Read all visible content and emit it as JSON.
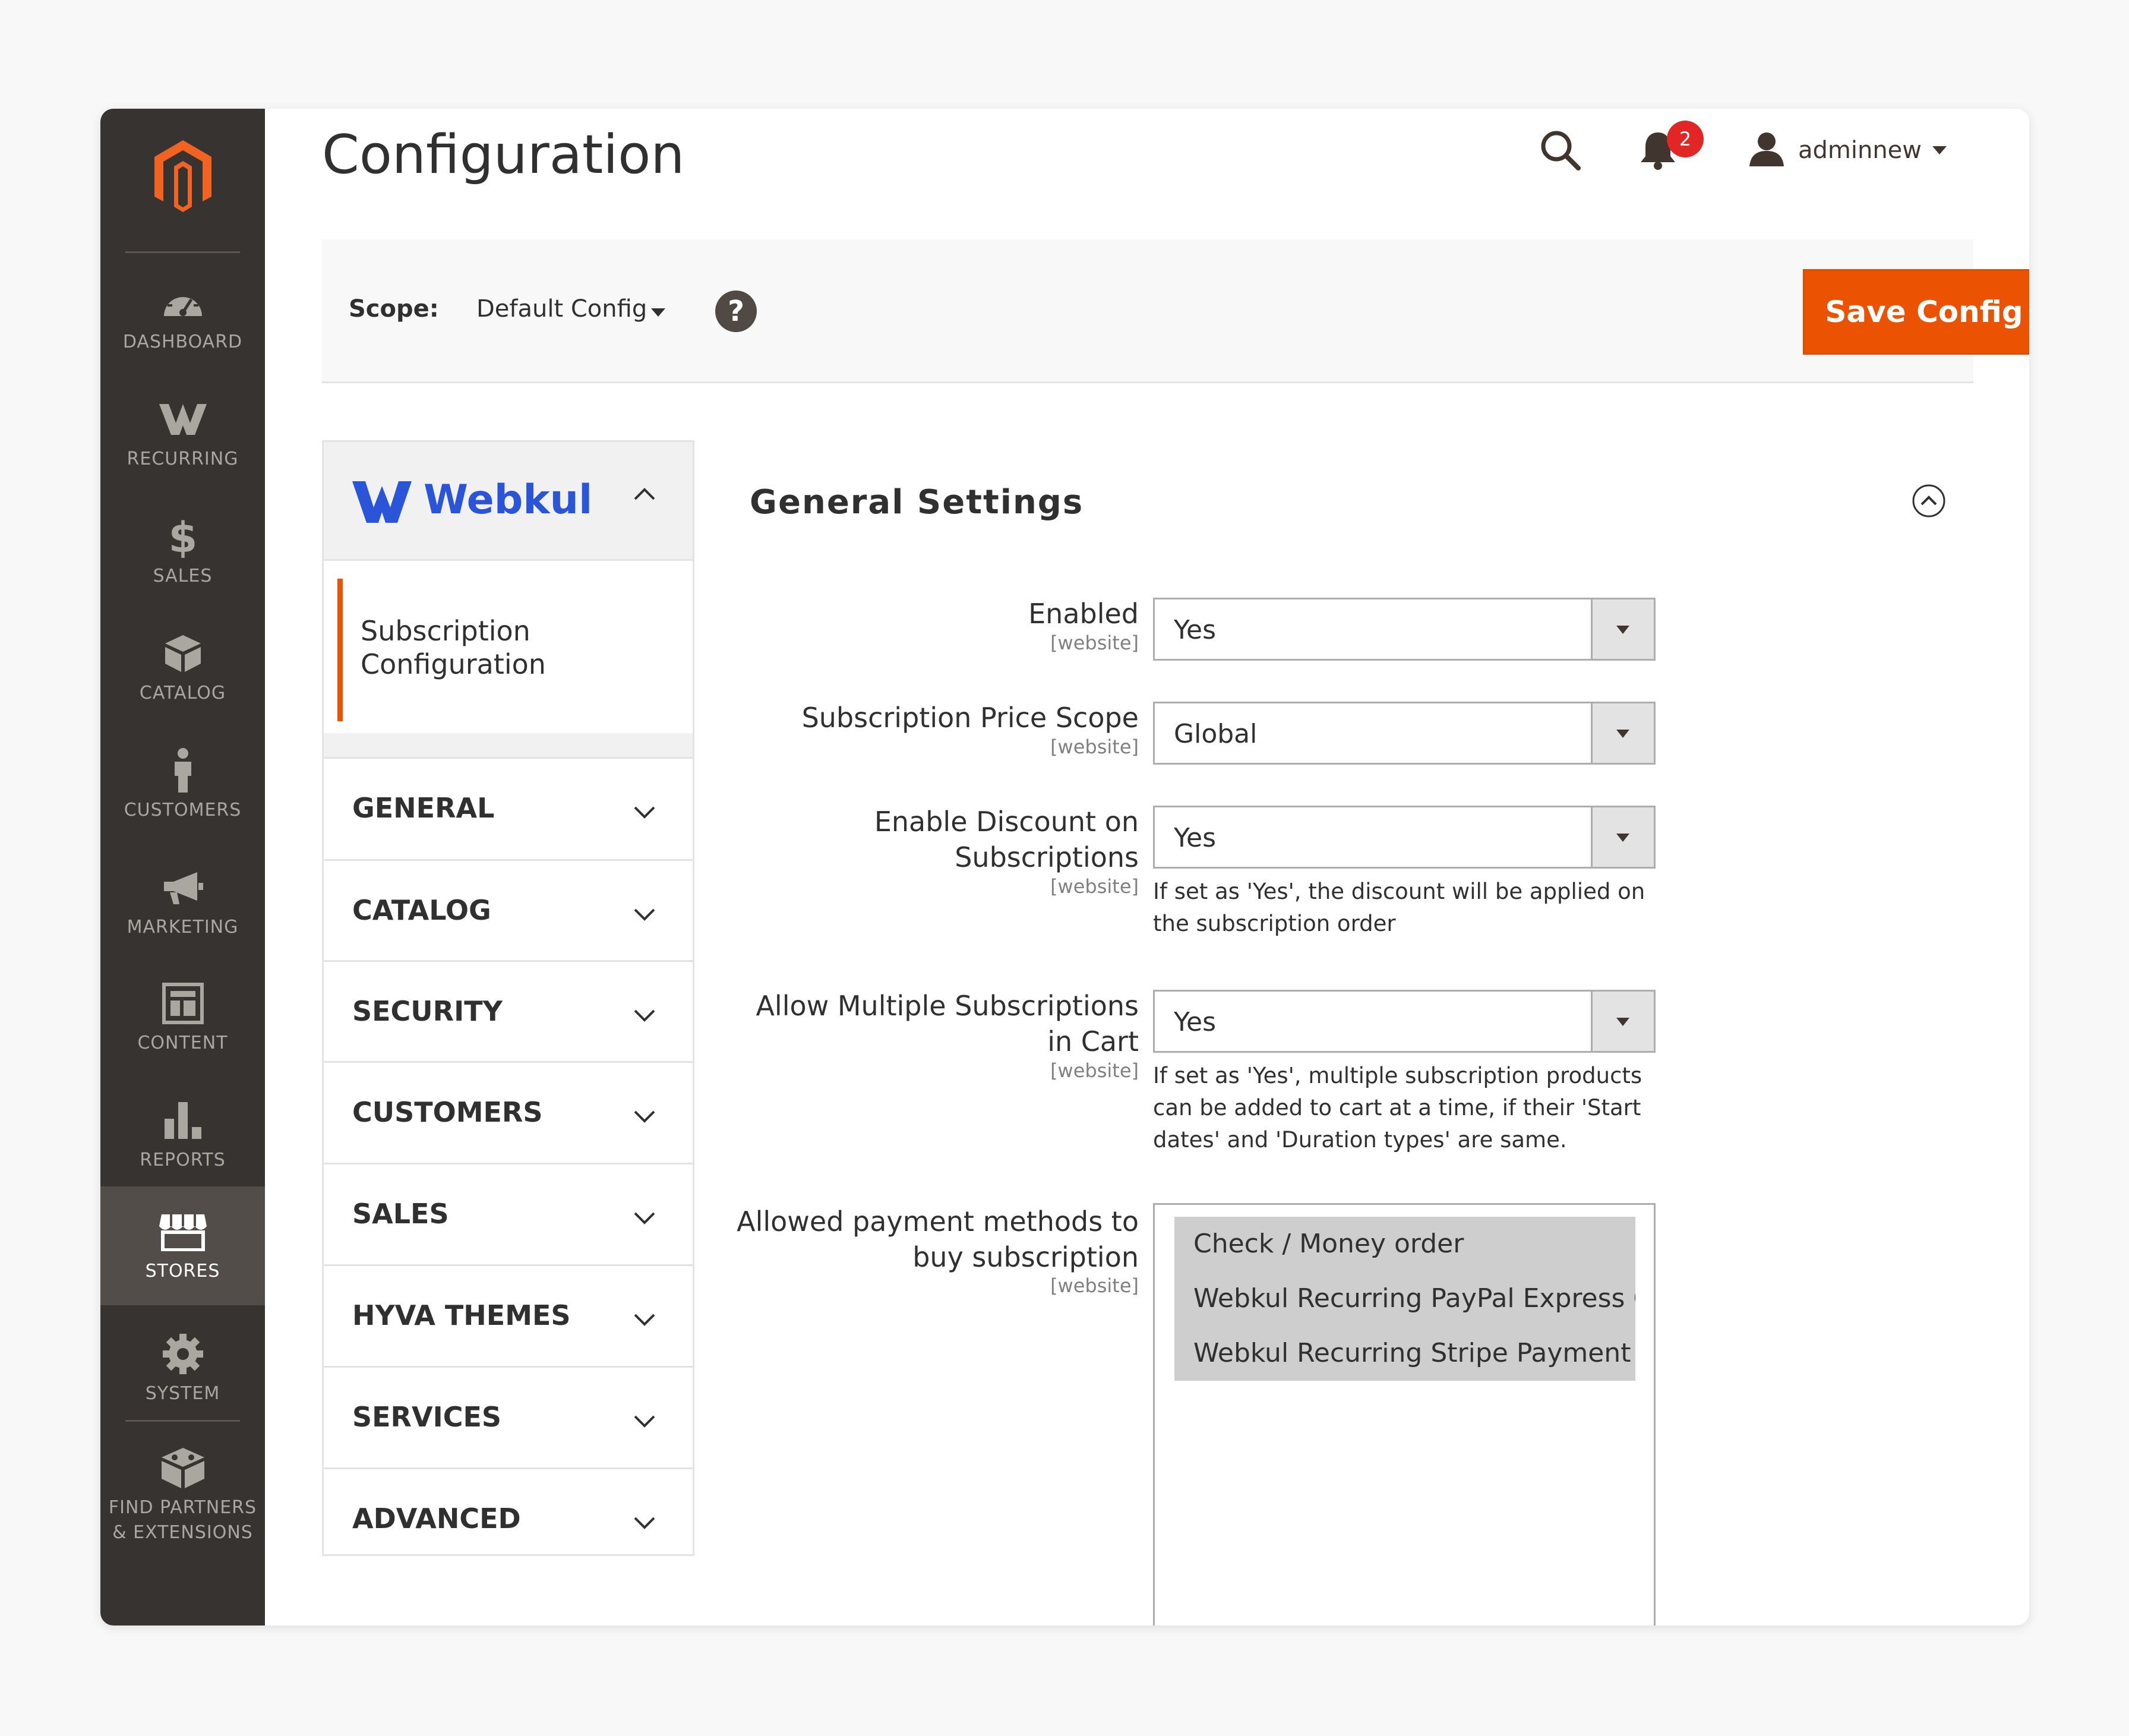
{
  "sidebar": {
    "logo": "magento-logo",
    "items": [
      {
        "label": "DASHBOARD",
        "icon": "dashboard-icon"
      },
      {
        "label": "RECURRING",
        "icon": "webkul-w-icon"
      },
      {
        "label": "SALES",
        "icon": "dollar-icon"
      },
      {
        "label": "CATALOG",
        "icon": "box-icon"
      },
      {
        "label": "CUSTOMERS",
        "icon": "person-icon"
      },
      {
        "label": "MARKETING",
        "icon": "megaphone-icon"
      },
      {
        "label": "CONTENT",
        "icon": "layout-icon"
      },
      {
        "label": "REPORTS",
        "icon": "bar-chart-icon"
      },
      {
        "label": "STORES",
        "icon": "store-icon",
        "active": true
      },
      {
        "label": "SYSTEM",
        "icon": "gear-icon"
      },
      {
        "label": "FIND PARTNERS\n& EXTENSIONS",
        "icon": "cube-icon"
      }
    ]
  },
  "header": {
    "title": "Configuration",
    "notifications_count": "2",
    "user": "adminnew"
  },
  "scope": {
    "label": "Scope:",
    "value": "Default Config",
    "save_label": "Save Config"
  },
  "tabs": {
    "brand": "Webkul",
    "active_item": "Subscription\nConfiguration",
    "sections": [
      "GENERAL",
      "CATALOG",
      "SECURITY",
      "CUSTOMERS",
      "SALES",
      "HYVA THEMES",
      "SERVICES",
      "ADVANCED"
    ]
  },
  "general_settings": {
    "title": "General Settings",
    "fields": [
      {
        "label": "Enabled",
        "scope": "[website]",
        "value": "Yes"
      },
      {
        "label": "Subscription Price Scope",
        "scope": "[website]",
        "value": "Global"
      },
      {
        "label": "Enable Discount on\nSubscriptions",
        "scope": "[website]",
        "value": "Yes",
        "note": "If set as 'Yes', the discount will be applied on the subscription order"
      },
      {
        "label": "Allow Multiple Subscriptions\nin Cart",
        "scope": "[website]",
        "value": "Yes",
        "note": "If set as 'Yes', multiple subscription products can be added to cart at a time, if their 'Start dates' and 'Duration types' are same."
      },
      {
        "label": "Allowed payment methods to\nbuy subscription",
        "scope": "[website]",
        "options": [
          "Check / Money order",
          "Webkul Recurring PayPal Express Checkout",
          "Webkul Recurring Stripe Payment Method"
        ]
      }
    ]
  },
  "colors": {
    "accent": "#eb5202",
    "sidebar_bg": "#373330",
    "webkul_blue": "#2b55d8"
  }
}
